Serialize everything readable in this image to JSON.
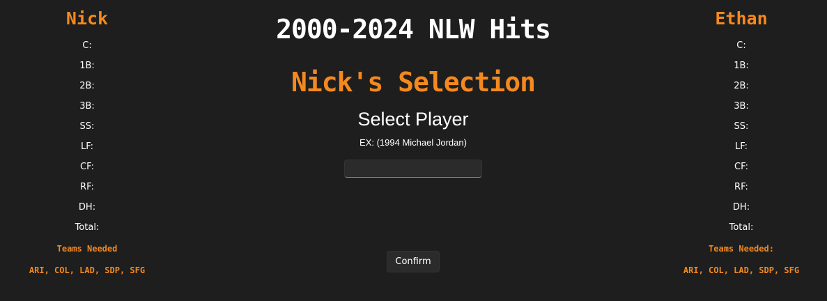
{
  "header": {
    "title": "2000-2024 NLW Hits",
    "selection": "Nick's Selection",
    "select_heading": "Select Player",
    "example": "EX: (1994 Michael Jordan)"
  },
  "input": {
    "value": "",
    "placeholder": ""
  },
  "confirm_label": "Confirm",
  "left_panel": {
    "name": "Nick",
    "positions": [
      "C:",
      "1B:",
      "2B:",
      "3B:",
      "SS:",
      "LF:",
      "CF:",
      "RF:",
      "DH:",
      "Total:"
    ],
    "teams_label": "Teams Needed",
    "teams": "ARI, COL, LAD, SDP, SFG"
  },
  "right_panel": {
    "name": "Ethan",
    "positions": [
      "C:",
      "1B:",
      "2B:",
      "3B:",
      "SS:",
      "LF:",
      "CF:",
      "RF:",
      "DH:",
      "Total:"
    ],
    "teams_label": "Teams Needed:",
    "teams": "ARI, COL, LAD, SDP, SFG"
  },
  "colors": {
    "background": "#1e1e1e",
    "accent": "#f4891f",
    "text": "#ffffff"
  }
}
